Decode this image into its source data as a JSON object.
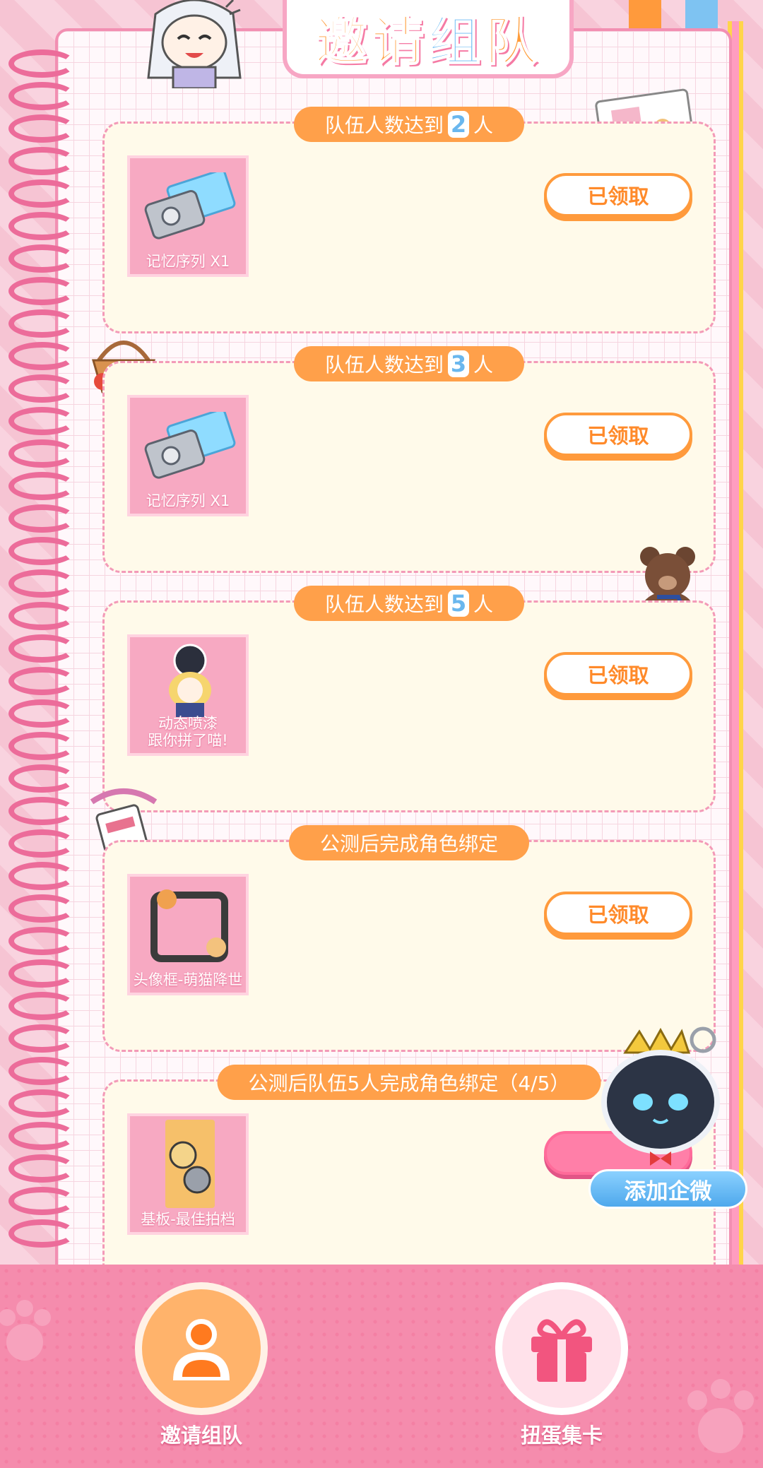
{
  "header": {
    "title_part1": "邀请",
    "title_part2": "组",
    "title_part3": "队"
  },
  "tiers": [
    {
      "title_prefix": "队伍人数达到",
      "title_num": "2",
      "title_suffix": "人",
      "reward_label": "记忆序列 X1",
      "button": "已领取",
      "reward_icon": "memory-sequence-icon"
    },
    {
      "title_prefix": "队伍人数达到",
      "title_num": "3",
      "title_suffix": "人",
      "reward_label": "记忆序列 X1",
      "button": "已领取",
      "reward_icon": "memory-sequence-icon"
    },
    {
      "title_prefix": "队伍人数达到",
      "title_num": "5",
      "title_suffix": "人",
      "reward_label_line1": "动态喷漆",
      "reward_label_line2": "跟你拼了喵!",
      "button": "已领取",
      "reward_icon": "spray-sticker-icon"
    },
    {
      "title": "公测后完成角色绑定",
      "reward_label": "头像框-萌猫降世",
      "button": "已领取",
      "reward_icon": "avatar-frame-icon"
    },
    {
      "title": "公测后队伍5人完成角色绑定（4/5）",
      "reward_label": "基板-最佳拍档",
      "reward_icon": "base-plate-icon"
    }
  ],
  "floating": {
    "add_wecom": "添加企微"
  },
  "bottom_nav": {
    "items": [
      {
        "label": "邀请组队",
        "icon": "team-icon"
      },
      {
        "label": "扭蛋集卡",
        "icon": "gift-icon"
      }
    ]
  },
  "colors": {
    "accent_orange": "#ff9a3c",
    "pink": "#f58cad",
    "blue": "#64b8f4",
    "card_bg": "#fffaea"
  }
}
